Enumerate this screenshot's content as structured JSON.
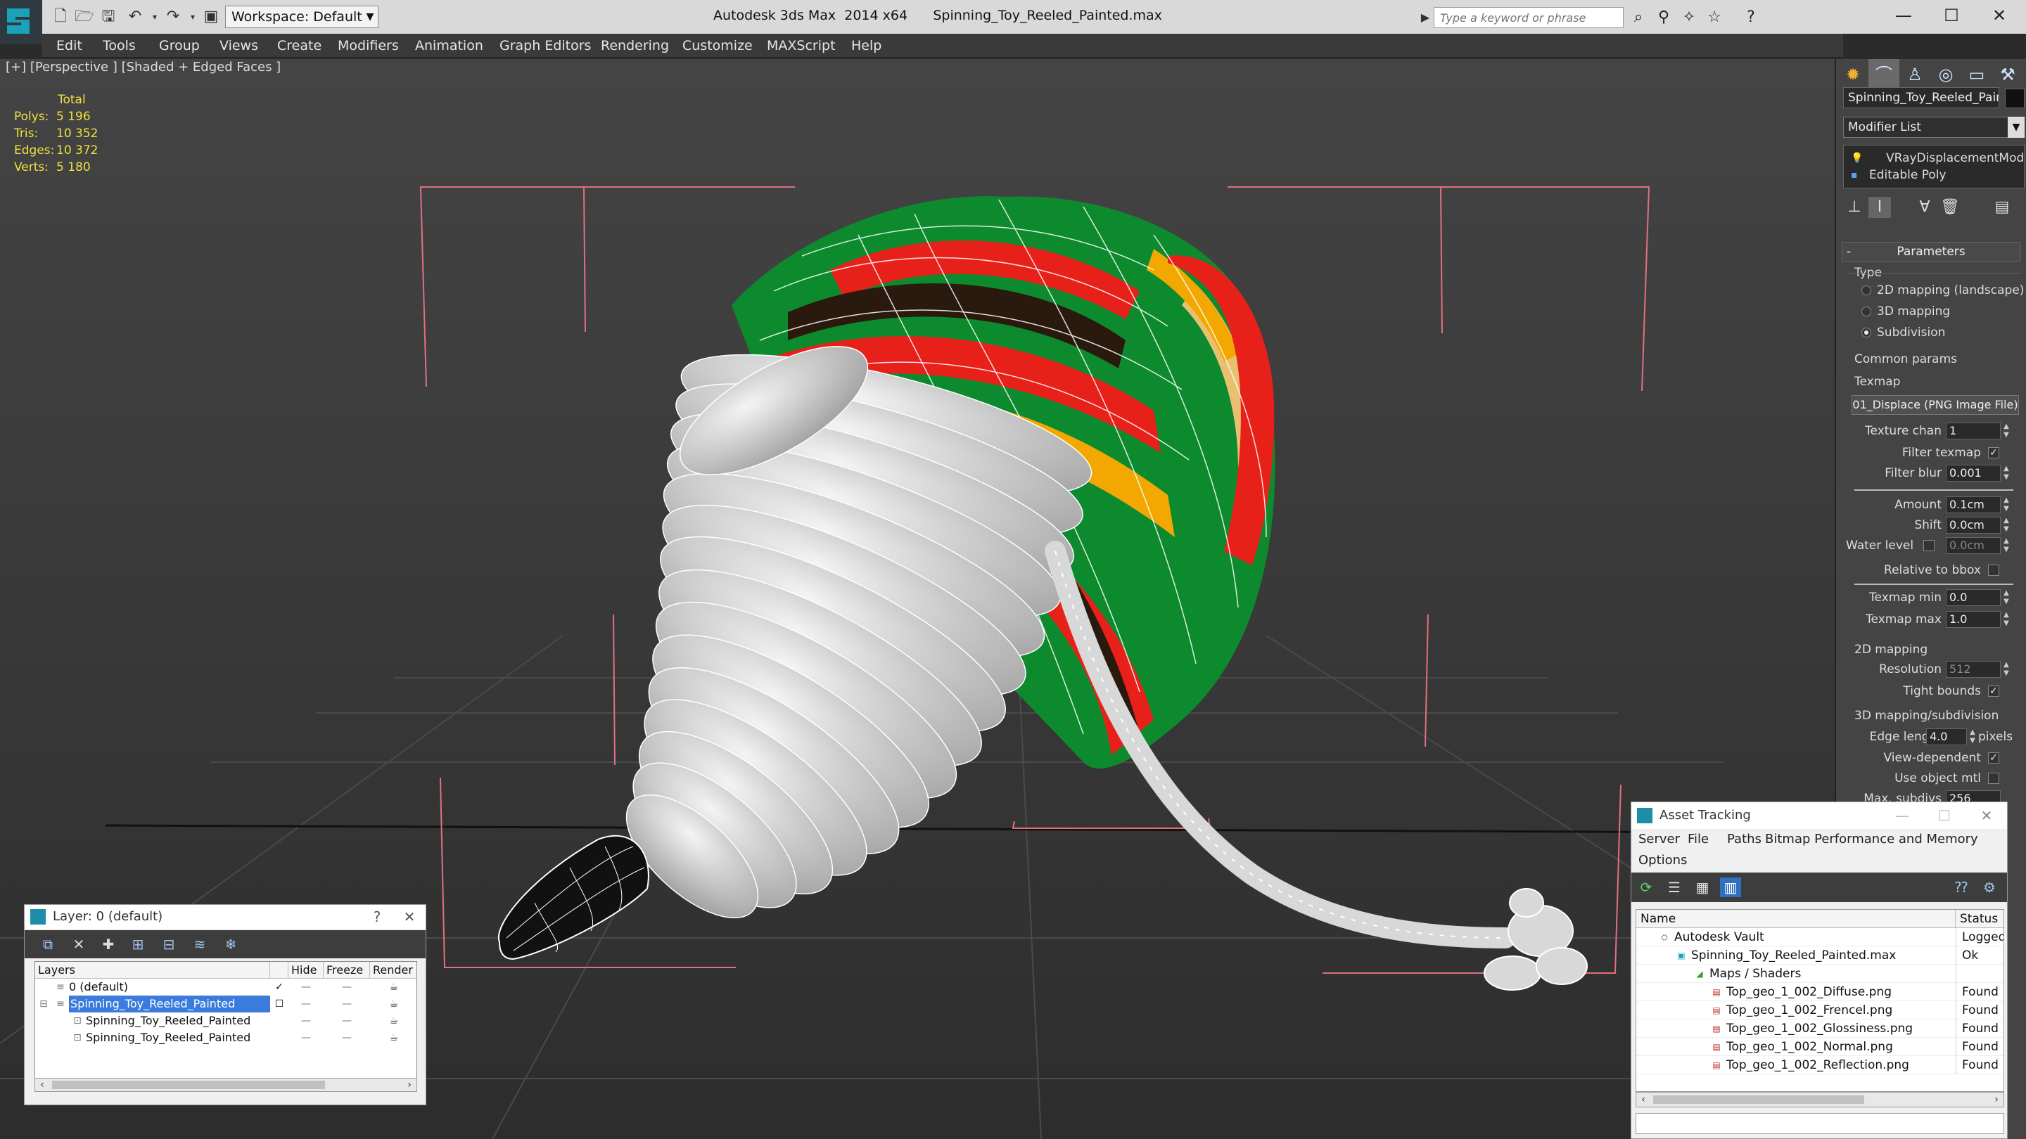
{
  "titlebar": {
    "workspace": "Workspace: Default",
    "app_title": "Autodesk 3ds Max  2014 x64",
    "file_title": "Spinning_Toy_Reeled_Painted.max",
    "search_placeholder": "Type a keyword or phrase"
  },
  "menu": [
    "Edit",
    "Tools",
    "Group",
    "Views",
    "Create",
    "Modifiers",
    "Animation",
    "Graph Editors",
    "Rendering",
    "Customize",
    "MAXScript",
    "Help"
  ],
  "viewport": {
    "label": "[+] [Perspective ] [Shaded + Edged Faces ]",
    "stats_header": "Total",
    "stats": [
      {
        "label": "Polys:",
        "value": "5 196"
      },
      {
        "label": "Tris:",
        "value": "10 352"
      },
      {
        "label": "Edges:",
        "value": "10 372"
      },
      {
        "label": "Verts:",
        "value": "5 180"
      }
    ],
    "stats_color": "#f0e040",
    "stripe_colors": [
      "#e8201a",
      "#0e8a2e",
      "#2a1a0e",
      "#f2a800",
      "#e8c070"
    ]
  },
  "command_panel": {
    "object_name": "Spinning_Toy_Reeled_Painted",
    "modifier_list": "Modifier List",
    "stack": [
      "VRayDisplacementMod",
      "Editable Poly"
    ],
    "parameters_title": "Parameters",
    "type_label": "Type",
    "type_options": [
      {
        "label": "2D mapping (landscape)",
        "selected": false
      },
      {
        "label": "3D mapping",
        "selected": false
      },
      {
        "label": "Subdivision",
        "selected": true
      }
    ],
    "common_params": "Common params",
    "texmap_label": "Texmap",
    "texmap_button": "01_Displace (PNG Image File)",
    "texture_chan_label": "Texture chan",
    "texture_chan": "1",
    "filter_texmap": "Filter texmap",
    "filter_blur_label": "Filter blur",
    "filter_blur": "0.001",
    "amount_label": "Amount",
    "amount": "0.1cm",
    "shift_label": "Shift",
    "shift": "0.0cm",
    "water_level_label": "Water level",
    "water_level": "0.0cm",
    "relative_bbox": "Relative to bbox",
    "texmap_min_label": "Texmap min",
    "texmap_min": "0.0",
    "texmap_max_label": "Texmap max",
    "texmap_max": "1.0",
    "mapping_2d": "2D mapping",
    "resolution_label": "Resolution",
    "resolution": "512",
    "tight_bounds": "Tight bounds",
    "mapping_3d": "3D mapping/subdivision",
    "edge_length_label": "Edge length",
    "edge_length": "4.0",
    "pixels": "pixels",
    "view_dependent": "View-dependent",
    "use_object_mtl": "Use object mtl",
    "max_subdivs_label": "Max. subdivs",
    "max_subdivs": "256"
  },
  "layer_dialog": {
    "title": "Layer: 0 (default)",
    "help": "?",
    "columns": {
      "layers": "Layers",
      "hide": "Hide",
      "freeze": "Freeze",
      "render": "Render"
    },
    "rows": [
      {
        "name": "0 (default)",
        "indent": 0,
        "selected": false
      },
      {
        "name": "Spinning_Toy_Reeled_Painted",
        "indent": 0,
        "selected": true
      },
      {
        "name": "Spinning_Toy_Reeled_Painted",
        "indent": 1,
        "selected": false
      },
      {
        "name": "Spinning_Toy_Reeled_Painted",
        "indent": 1,
        "selected": false
      }
    ]
  },
  "asset_tracking": {
    "title": "Asset Tracking",
    "menu": [
      "Server",
      "File",
      "Paths",
      "Bitmap Performance and Memory",
      "Options"
    ],
    "columns": {
      "name": "Name",
      "status": "Status"
    },
    "rows": [
      {
        "name": "Autodesk Vault",
        "status": "Logged",
        "indent": 0,
        "icon": "vault-icon"
      },
      {
        "name": "Spinning_Toy_Reeled_Painted.max",
        "status": "Ok",
        "indent": 1,
        "icon": "max-file-icon"
      },
      {
        "name": "Maps / Shaders",
        "status": "",
        "indent": 2,
        "icon": "maps-icon"
      },
      {
        "name": "Top_geo_1_002_Diffuse.png",
        "status": "Found",
        "indent": 3,
        "icon": "png-icon"
      },
      {
        "name": "Top_geo_1_002_Frencel.png",
        "status": "Found",
        "indent": 3,
        "icon": "png-icon"
      },
      {
        "name": "Top_geo_1_002_Glossiness.png",
        "status": "Found",
        "indent": 3,
        "icon": "png-icon"
      },
      {
        "name": "Top_geo_1_002_Normal.png",
        "status": "Found",
        "indent": 3,
        "icon": "png-icon"
      },
      {
        "name": "Top_geo_1_002_Reflection.png",
        "status": "Found",
        "indent": 3,
        "icon": "png-icon"
      }
    ]
  }
}
